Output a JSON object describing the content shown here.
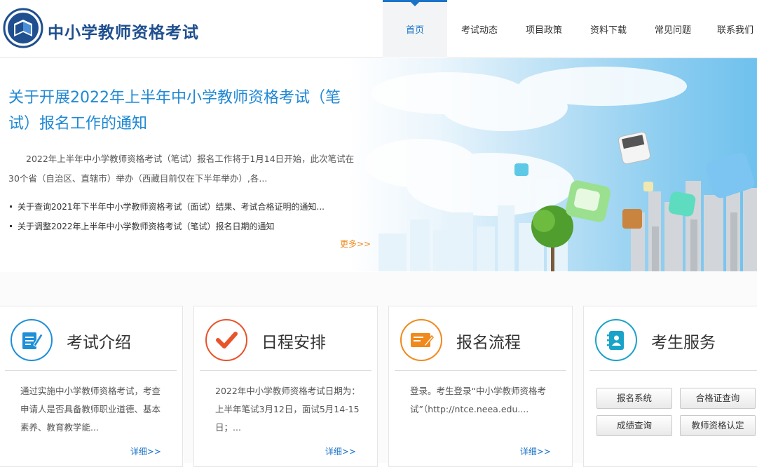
{
  "header": {
    "site_title": "中小学教师资格考试",
    "nav": [
      {
        "label": "首页",
        "active": true
      },
      {
        "label": "考试动态",
        "active": false
      },
      {
        "label": "项目政策",
        "active": false
      },
      {
        "label": "资料下载",
        "active": false
      },
      {
        "label": "常见问题",
        "active": false
      },
      {
        "label": "联系我们",
        "active": false
      }
    ]
  },
  "banner": {
    "title": "关于开展2022年上半年中小学教师资格考试（笔试）报名工作的通知",
    "description": "2022年上半年中小学教师资格考试（笔试）报名工作将于1月14日开始，此次笔试在30个省（自治区、直辖市）举办（西藏目前仅在下半年举办）,各...",
    "news": [
      "关于查询2021年下半年中小学教师资格考试（面试）结果、考试合格证明的通知...",
      "关于调整2022年上半年中小学教师资格考试（笔试）报名日期的通知"
    ],
    "more": "更多>>"
  },
  "cards": [
    {
      "title": "考试介绍",
      "icon": "document-edit-icon",
      "color": "#1f8fd8",
      "body": "通过实施中小学教师资格考试，考查申请人是否具备教师职业道德、基本素养、教育教学能...",
      "more": "详细>>"
    },
    {
      "title": "日程安排",
      "icon": "checkmark-icon",
      "color": "#e8532a",
      "body": "2022年中小学教师资格考试日期为：上半年笔试3月12日，面试5月14-15日；...",
      "more": "详细>>"
    },
    {
      "title": "报名流程",
      "icon": "form-pen-icon",
      "color": "#f08a1c",
      "body": "登录。考生登录“中小学教师资格考试”（http://ntce.neea.edu....",
      "more": "详细>>"
    },
    {
      "title": "考生服务",
      "icon": "contact-book-icon",
      "color": "#1aa3c8",
      "buttons": [
        "报名系统",
        "合格证查询",
        "成绩查询",
        "教师资格认定"
      ]
    }
  ]
}
